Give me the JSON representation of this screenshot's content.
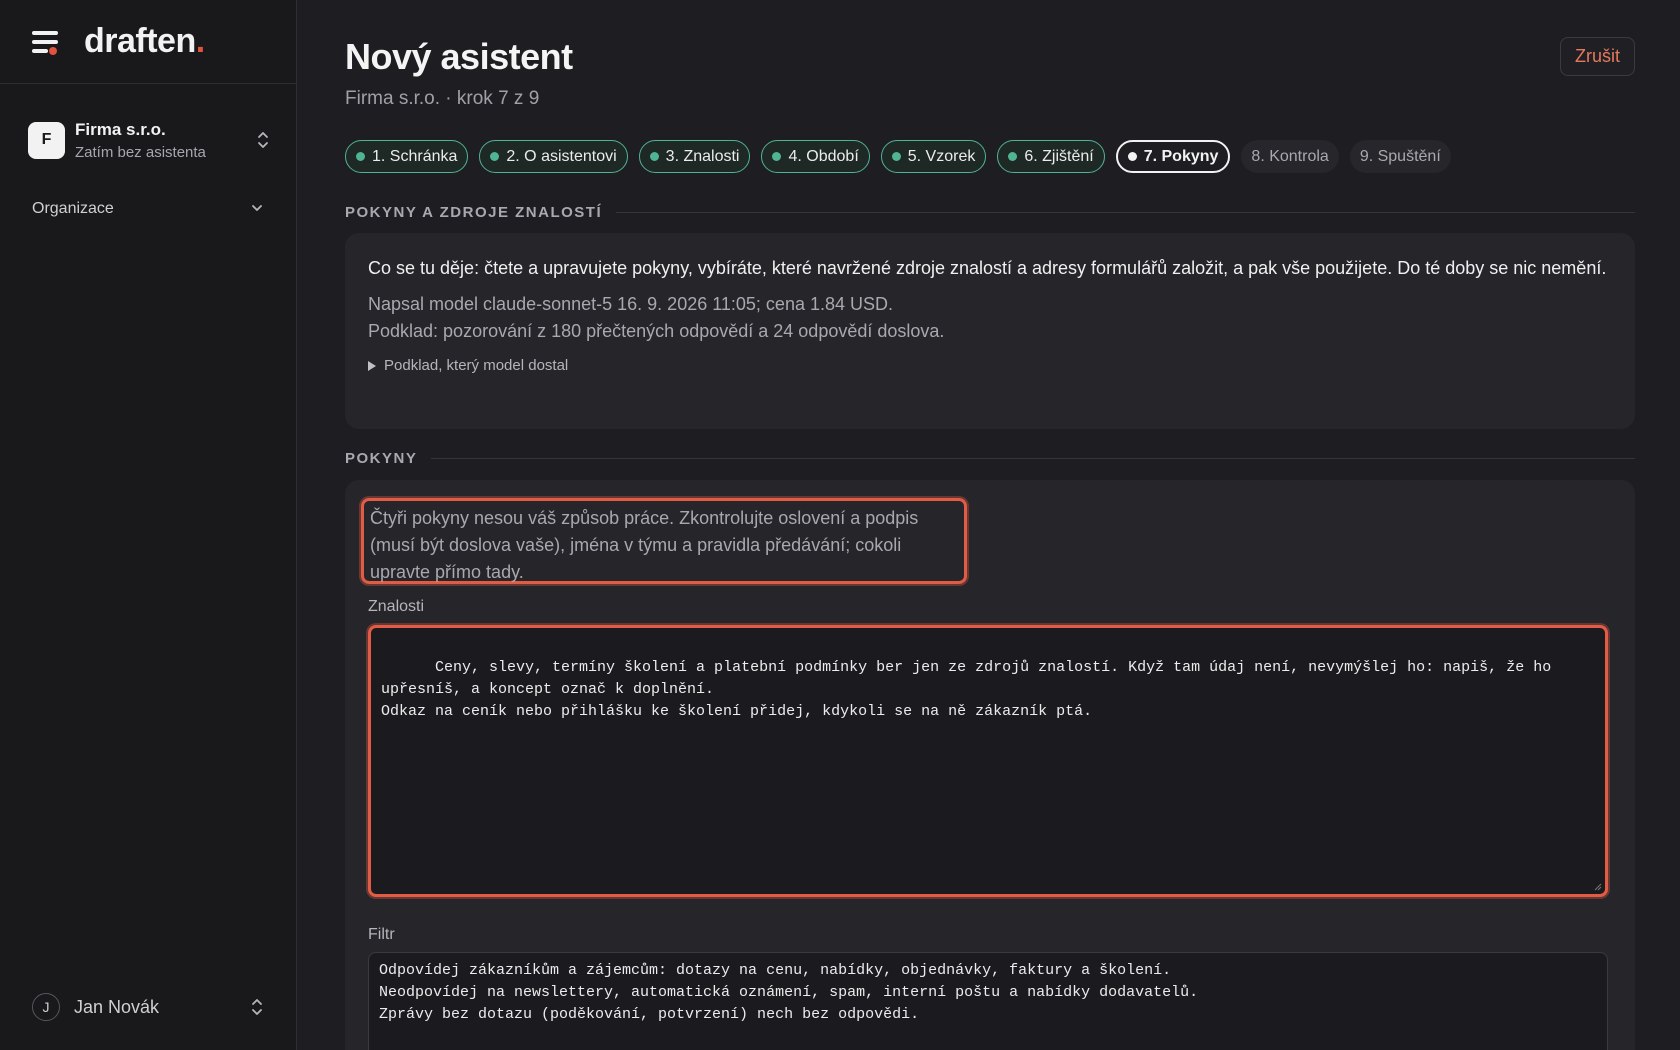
{
  "app": {
    "logo_text": "draften",
    "logo_dot": "."
  },
  "sidebar": {
    "org": {
      "avatar": "F",
      "name": "Firma s.r.o.",
      "subtitle": "Zatím bez asistenta"
    },
    "menu": {
      "organization_label": "Organizace"
    },
    "user": {
      "avatar": "J",
      "name": "Jan Novák"
    }
  },
  "header": {
    "title": "Nový asistent",
    "subtitle": "Firma s.r.o. · krok 7 z 9",
    "cancel_label": "Zrušit"
  },
  "steps": [
    {
      "label": "1. Schránka",
      "state": "done"
    },
    {
      "label": "2. O asistentovi",
      "state": "done"
    },
    {
      "label": "3. Znalosti",
      "state": "done"
    },
    {
      "label": "4. Období",
      "state": "done"
    },
    {
      "label": "5. Vzorek",
      "state": "done"
    },
    {
      "label": "6. Zjištění",
      "state": "done"
    },
    {
      "label": "7. Pokyny",
      "state": "current"
    },
    {
      "label": "8. Kontrola",
      "state": "todo"
    },
    {
      "label": "9. Spuštění",
      "state": "todo"
    }
  ],
  "info_section": {
    "label": "POKYNY A ZDROJE ZNALOSTÍ",
    "lead": "Co se tu děje: čtete a upravujete pokyny, vybíráte, které navržené zdroje znalostí a adresy formulářů založit, a pak vše použijete. Do té doby se nic nemění.",
    "meta_line1": "Napsal model claude-sonnet-5 16. 9. 2026 11:05; cena 1.84 USD.",
    "meta_line2": "Podklad: pozorování z 180 přečtených odpovědí a 24 odpovědí doslova.",
    "details_label": "Podklad, který model dostal"
  },
  "pokyny_section": {
    "label": "POKYNY",
    "hint": "Čtyři pokyny nesou váš způsob práce. Zkontrolujte oslovení a podpis (musí být doslova vaše), jména v týmu a pravidla předávání; cokoli upravte přímo tady.",
    "knowledge_label": "Znalosti",
    "knowledge_value": "Ceny, slevy, termíny školení a platební podmínky ber jen ze zdrojů znalostí. Když tam údaj není, nevymýšlej ho: napiš, že ho upřesníš, a koncept označ k doplnění.\nOdkaz na ceník nebo přihlášku ke školení přidej, kdykoli se na ně zákazník ptá.",
    "filter_label": "Filtr",
    "filter_value": "Odpovídej zákazníkům a zájemcům: dotazy na cenu, nabídky, objednávky, faktury a školení.\nNeodpovídej na newslettery, automatická oznámení, spam, interní poštu a nabídky dodavatelů.\nZprávy bez dotazu (poděkování, potvrzení) nech bez odpovědi."
  },
  "colors": {
    "accent": "#e0533d",
    "done": "#4fb394",
    "background": "#1e1e22"
  }
}
